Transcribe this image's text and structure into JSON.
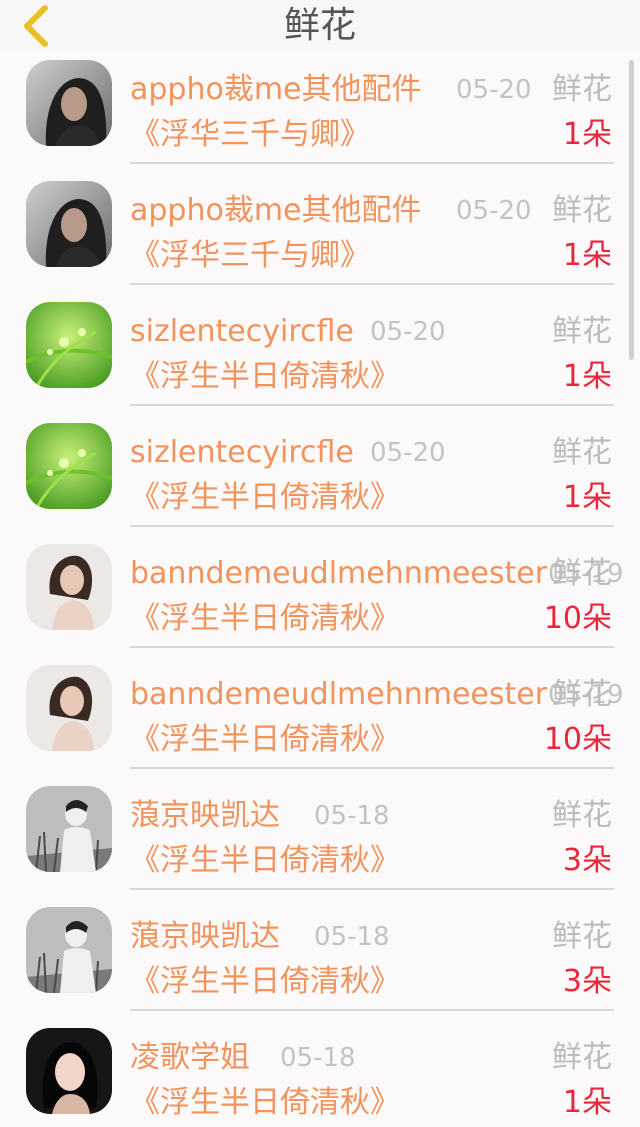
{
  "header": {
    "title": "鲜花",
    "back_icon": "chevron-left-icon"
  },
  "colors": {
    "name": "#f2935c",
    "count": "#e8273c",
    "meta": "#c3c3c3",
    "back": "#e9c125"
  },
  "rows": [
    {
      "name": "appho裁me其他配件",
      "date": "05-20",
      "type": "鲜花",
      "book": "《浮华三千与卿》",
      "count": "1朵",
      "avatar": "woman-dark-hair"
    },
    {
      "name": "appho裁me其他配件",
      "date": "05-20",
      "type": "鲜花",
      "book": "《浮华三千与卿》",
      "count": "1朵",
      "avatar": "woman-dark-hair"
    },
    {
      "name": "sizlentecyircfle",
      "date": "05-20",
      "type": "鲜花",
      "book": "《浮生半日倚清秋》",
      "count": "1朵",
      "avatar": "green-plant"
    },
    {
      "name": "sizlentecyircfle",
      "date": "05-20",
      "type": "鲜花",
      "book": "《浮生半日倚清秋》",
      "count": "1朵",
      "avatar": "green-plant"
    },
    {
      "name": "banndemeudlmehnmeester",
      "date": "05-19",
      "type": "鲜花",
      "book": "《浮生半日倚清秋》",
      "count": "10朵",
      "avatar": "woman-light"
    },
    {
      "name": "banndemeudlmehnmeester",
      "date": "05-19",
      "type": "鲜花",
      "book": "《浮生半日倚清秋》",
      "count": "10朵",
      "avatar": "woman-light"
    },
    {
      "name": "蒗京映凯达",
      "date": "05-18",
      "type": "鲜花",
      "book": "《浮生半日倚清秋》",
      "count": "3朵",
      "avatar": "monochrome-person"
    },
    {
      "name": "蒗京映凯达",
      "date": "05-18",
      "type": "鲜花",
      "book": "《浮生半日倚清秋》",
      "count": "3朵",
      "avatar": "monochrome-person"
    },
    {
      "name": "凌歌学姐",
      "date": "05-18",
      "type": "鲜花",
      "book": "《浮生半日倚清秋》",
      "count": "1朵",
      "avatar": "girl-portrait"
    }
  ]
}
